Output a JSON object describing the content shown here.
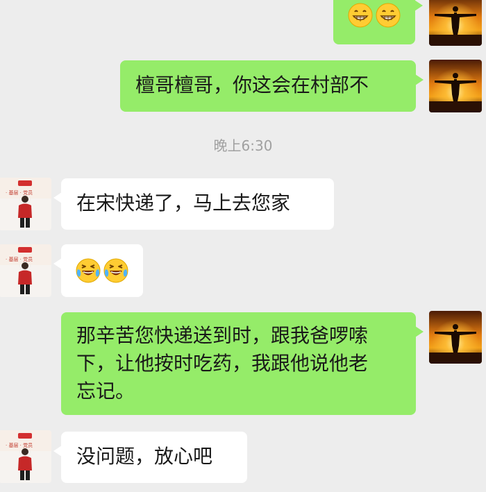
{
  "chat": {
    "timestamp": "晚上6:30",
    "messages": [
      {
        "id": "m1",
        "side": "out",
        "type": "emoji",
        "emoji": [
          "grinning-face-emoji",
          "grinning-face-emoji"
        ]
      },
      {
        "id": "m2",
        "side": "out",
        "type": "text",
        "text": "檀哥檀哥，你这会在村部不"
      },
      {
        "id": "m3",
        "side": "in",
        "type": "text",
        "text": "在宋快递了，马上去您家"
      },
      {
        "id": "m4",
        "side": "in",
        "type": "emoji",
        "emoji": [
          "crying-laughing-emoji",
          "crying-laughing-emoji"
        ]
      },
      {
        "id": "m5",
        "side": "out",
        "type": "text",
        "lines": [
          "那辛苦您快递送到时，跟我爸啰嗦",
          "下，让他按时吃药，我跟他说他老",
          "忘记。"
        ]
      },
      {
        "id": "m6",
        "side": "in",
        "type": "text",
        "text": "没问题，放心吧"
      }
    ]
  },
  "colors": {
    "background": "#ededed",
    "outgoing_bubble": "#95ec69",
    "incoming_bubble": "#ffffff",
    "timestamp_text": "#a0a0a0"
  },
  "avatars": {
    "self": "sunset-silhouette-avatar-icon",
    "contact": "red-jacket-person-avatar-icon"
  }
}
